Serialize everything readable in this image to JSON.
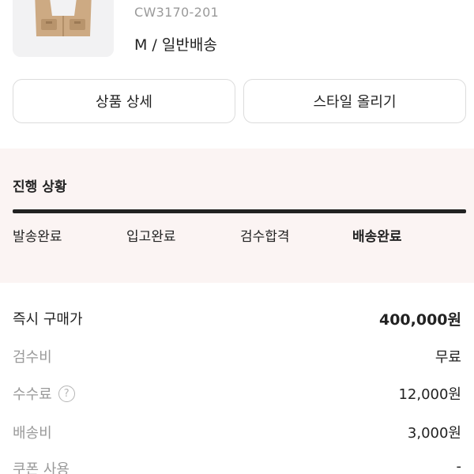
{
  "product": {
    "thumbnail": "vest-product-image",
    "sku": "CW3170-201",
    "option": "M / 일반배송"
  },
  "actions": {
    "detail_label": "상품 상세",
    "style_label": "스타일 올리기"
  },
  "progress": {
    "title": "진행 상황",
    "steps": [
      "발송완료",
      "입고완료",
      "검수합격",
      "배송완료"
    ],
    "current_step": "배송완료",
    "completion": 1.0
  },
  "prices": [
    {
      "label": "즉시 구매가",
      "value": "400,000원",
      "emphasis": true
    },
    {
      "label": "검수비",
      "value": "무료"
    },
    {
      "label": "수수료",
      "value": "12,000원",
      "help_icon": "question-circle-icon"
    },
    {
      "label": "배송비",
      "value": "3,000원"
    },
    {
      "label": "쿠폰 사용",
      "value": "-"
    }
  ],
  "colors": {
    "progress_bg": "#fbf4f3",
    "progress_bar": "#222222",
    "muted_text": "#9a9a9a"
  }
}
